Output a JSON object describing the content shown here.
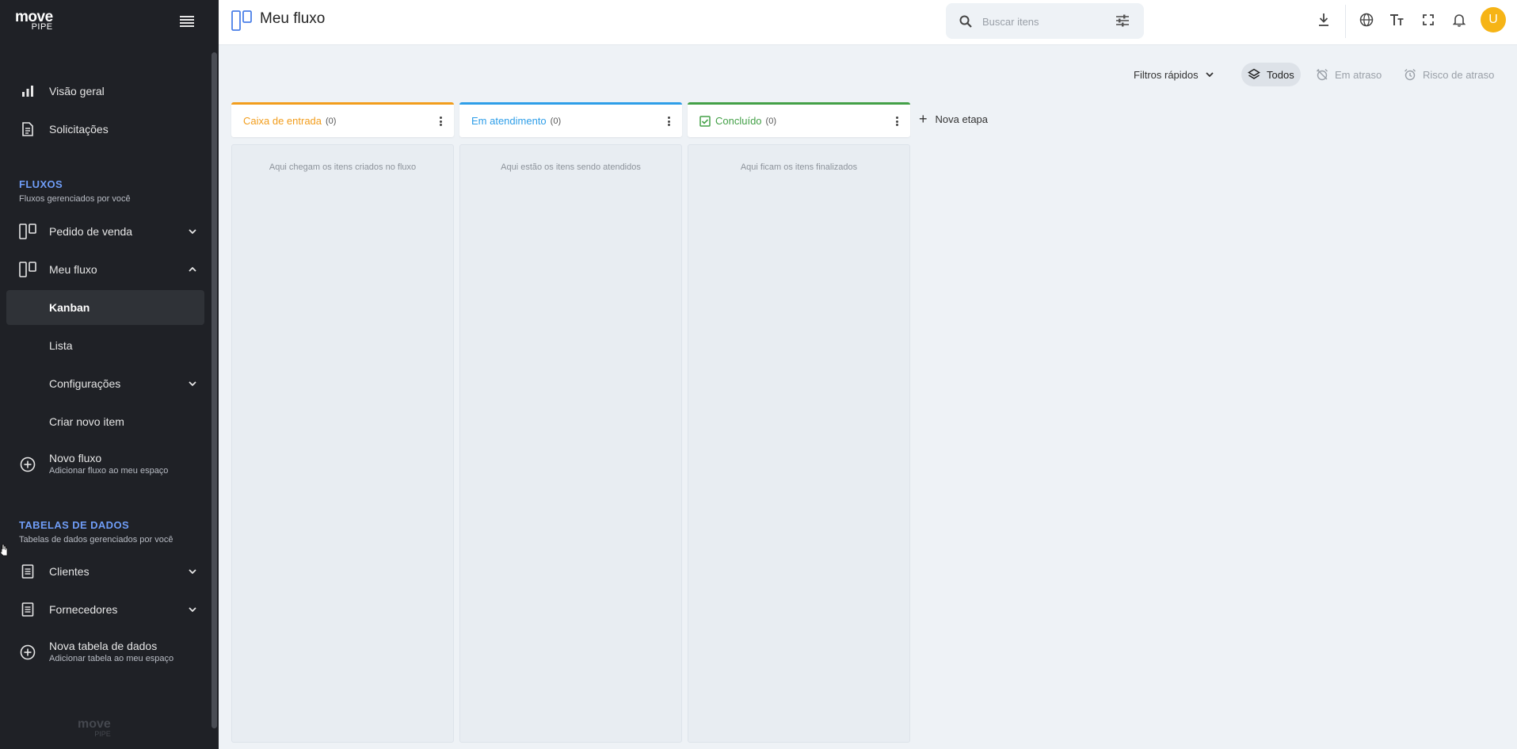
{
  "brand": {
    "name": "move",
    "sub": "PIPE"
  },
  "sidebar": {
    "items_top": [
      {
        "label": "Visão geral",
        "icon": "bar-chart-icon"
      },
      {
        "label": "Solicitações",
        "icon": "document-icon"
      }
    ],
    "fluxos": {
      "title": "FLUXOS",
      "subtitle": "Fluxos gerenciados por você",
      "items": [
        {
          "label": "Pedido de venda",
          "icon": "kanban-icon"
        },
        {
          "label": "Meu fluxo",
          "icon": "kanban-icon"
        }
      ],
      "sub_items": [
        "Kanban",
        "Lista",
        "Configurações",
        "Criar novo item"
      ],
      "new_label": "Novo fluxo",
      "new_sub": "Adicionar fluxo ao meu espaço"
    },
    "tabelas": {
      "title": "TABELAS DE DADOS",
      "subtitle": "Tabelas de dados gerenciados por você",
      "items": [
        {
          "label": "Clientes",
          "icon": "table-icon"
        },
        {
          "label": "Fornecedores",
          "icon": "table-icon"
        }
      ],
      "new_label": "Nova tabela de dados",
      "new_sub": "Adicionar tabela ao meu espaço"
    },
    "footer_logo": {
      "name": "move",
      "sub": "PIPE"
    }
  },
  "header": {
    "title": "Meu fluxo",
    "search_placeholder": "Buscar itens",
    "avatar_letter": "U"
  },
  "filters": {
    "quick_label": "Filtros rápidos",
    "chips": [
      "Todos",
      "Em atraso",
      "Risco de atraso"
    ],
    "selected": "Todos"
  },
  "kanban": {
    "columns": [
      {
        "title": "Caixa de entrada",
        "count": "(0)",
        "color": "#f29d1c",
        "empty": "Aqui chegam os itens criados no fluxo"
      },
      {
        "title": "Em atendimento",
        "count": "(0)",
        "color": "#2e9ee8",
        "empty": "Aqui estão os itens sendo atendidos"
      },
      {
        "title": "Concluído",
        "count": "(0)",
        "color": "#43a047",
        "empty": "Aqui ficam os itens finalizados"
      }
    ],
    "add_stage_label": "Nova etapa"
  },
  "colors": {
    "accent": "#6f9df7",
    "sidebar_bg": "#1f2126",
    "avatar": "#f6b416"
  }
}
